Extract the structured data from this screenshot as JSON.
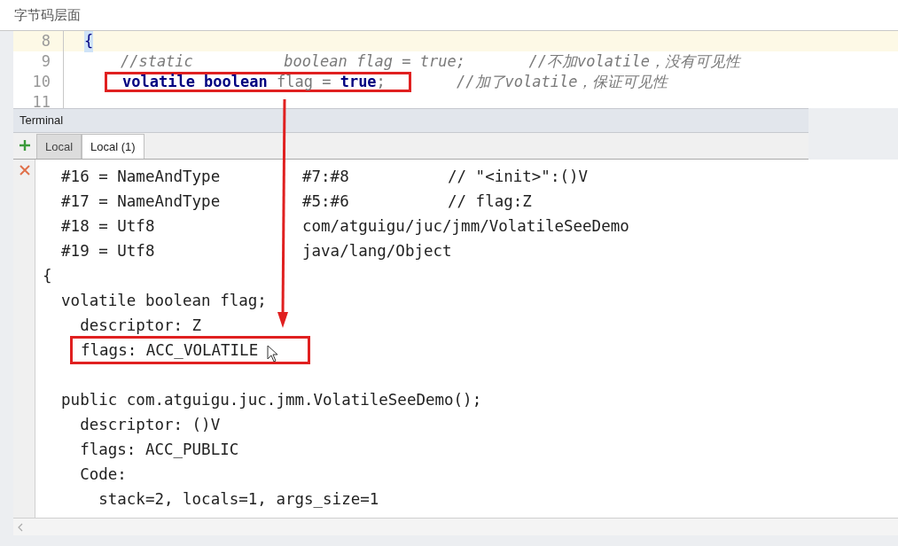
{
  "title": "字节码层面",
  "editor": {
    "lines": [
      {
        "number": "8",
        "current": true,
        "segments": [
          {
            "kind": "brace",
            "text": "{"
          }
        ]
      },
      {
        "number": "9",
        "current": false,
        "segments": [
          {
            "kind": "comment",
            "text": "    //static          boolean flag = true;"
          },
          {
            "kind": "comment",
            "text": "       //不加volatile，没有可见性"
          }
        ]
      },
      {
        "number": "10",
        "current": false,
        "highlighted": true,
        "segments": [
          {
            "kind": "code",
            "text": "**volatile boolean** flag = **true**;"
          },
          {
            "kind": "comment",
            "text": "     //加了volatile，保证可见性"
          }
        ]
      },
      {
        "number": "11",
        "current": false
      }
    ]
  },
  "terminal": {
    "title": "Terminal",
    "tabs": [
      {
        "label": "Local",
        "selected": false
      },
      {
        "label": "Local (1)",
        "selected": true
      }
    ],
    "lines": [
      {
        "kind": "pool",
        "cells": [
          "  #16 = NameAndType",
          "#7:#8",
          "// \"<init>\":()V"
        ]
      },
      {
        "kind": "pool",
        "cells": [
          "  #17 = NameAndType",
          "#5:#6",
          "// flag:Z"
        ]
      },
      {
        "kind": "pool",
        "cells": [
          "  #18 = Utf8",
          "com/atguigu/juc/jmm/VolatileSeeDemo"
        ]
      },
      {
        "kind": "pool",
        "cells": [
          "  #19 = Utf8",
          "java/lang/Object"
        ]
      },
      {
        "kind": "text",
        "highlighted": false,
        "text": "{"
      },
      {
        "kind": "text",
        "highlighted": false,
        "text": "  volatile boolean flag;"
      },
      {
        "kind": "text",
        "highlighted": false,
        "text": "    descriptor: Z"
      },
      {
        "kind": "text",
        "highlighted": true,
        "text": "flags: ACC_VOLATILE"
      },
      {
        "kind": "blank"
      },
      {
        "kind": "text",
        "highlighted": false,
        "text": "  public com.atguigu.juc.jmm.VolatileSeeDemo();"
      },
      {
        "kind": "text",
        "highlighted": false,
        "text": "    descriptor: ()V"
      },
      {
        "kind": "text",
        "highlighted": false,
        "text": "    flags: ACC_PUBLIC"
      },
      {
        "kind": "text",
        "highlighted": false,
        "text": "    Code:"
      },
      {
        "kind": "text",
        "highlighted": false,
        "text": "      stack=2, locals=1, args_size=1"
      }
    ]
  }
}
